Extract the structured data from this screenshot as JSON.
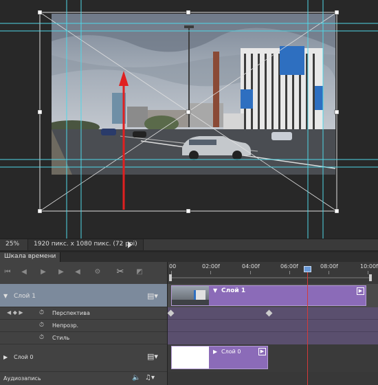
{
  "canvas": {
    "description_icons": [
      "transform-handles",
      "guide-lines",
      "red-arrow"
    ]
  },
  "statusbar": {
    "zoom": "25%",
    "doc_info": "1920 пикс. x 1080 пикс. (72 ppi)"
  },
  "timeline": {
    "tab_label": "Шкала времени",
    "ruler_labels": [
      "00",
      "02:00f",
      "04:00f",
      "06:00f",
      "08:00f",
      "10:00f"
    ],
    "layers": [
      {
        "name": "Слой 1",
        "clip_title": "Слой 1",
        "properties": [
          "Перспектива",
          "Непрозр.",
          "Стиль"
        ]
      },
      {
        "name": "Слой 0",
        "clip_title": "Слой 0"
      }
    ],
    "audio_label": "Аудиозапись",
    "colors": {
      "clip": "#8b6bb8",
      "playhead": "#d43a3a",
      "guide": "#4fd8e8",
      "arrow": "#e02020"
    }
  }
}
